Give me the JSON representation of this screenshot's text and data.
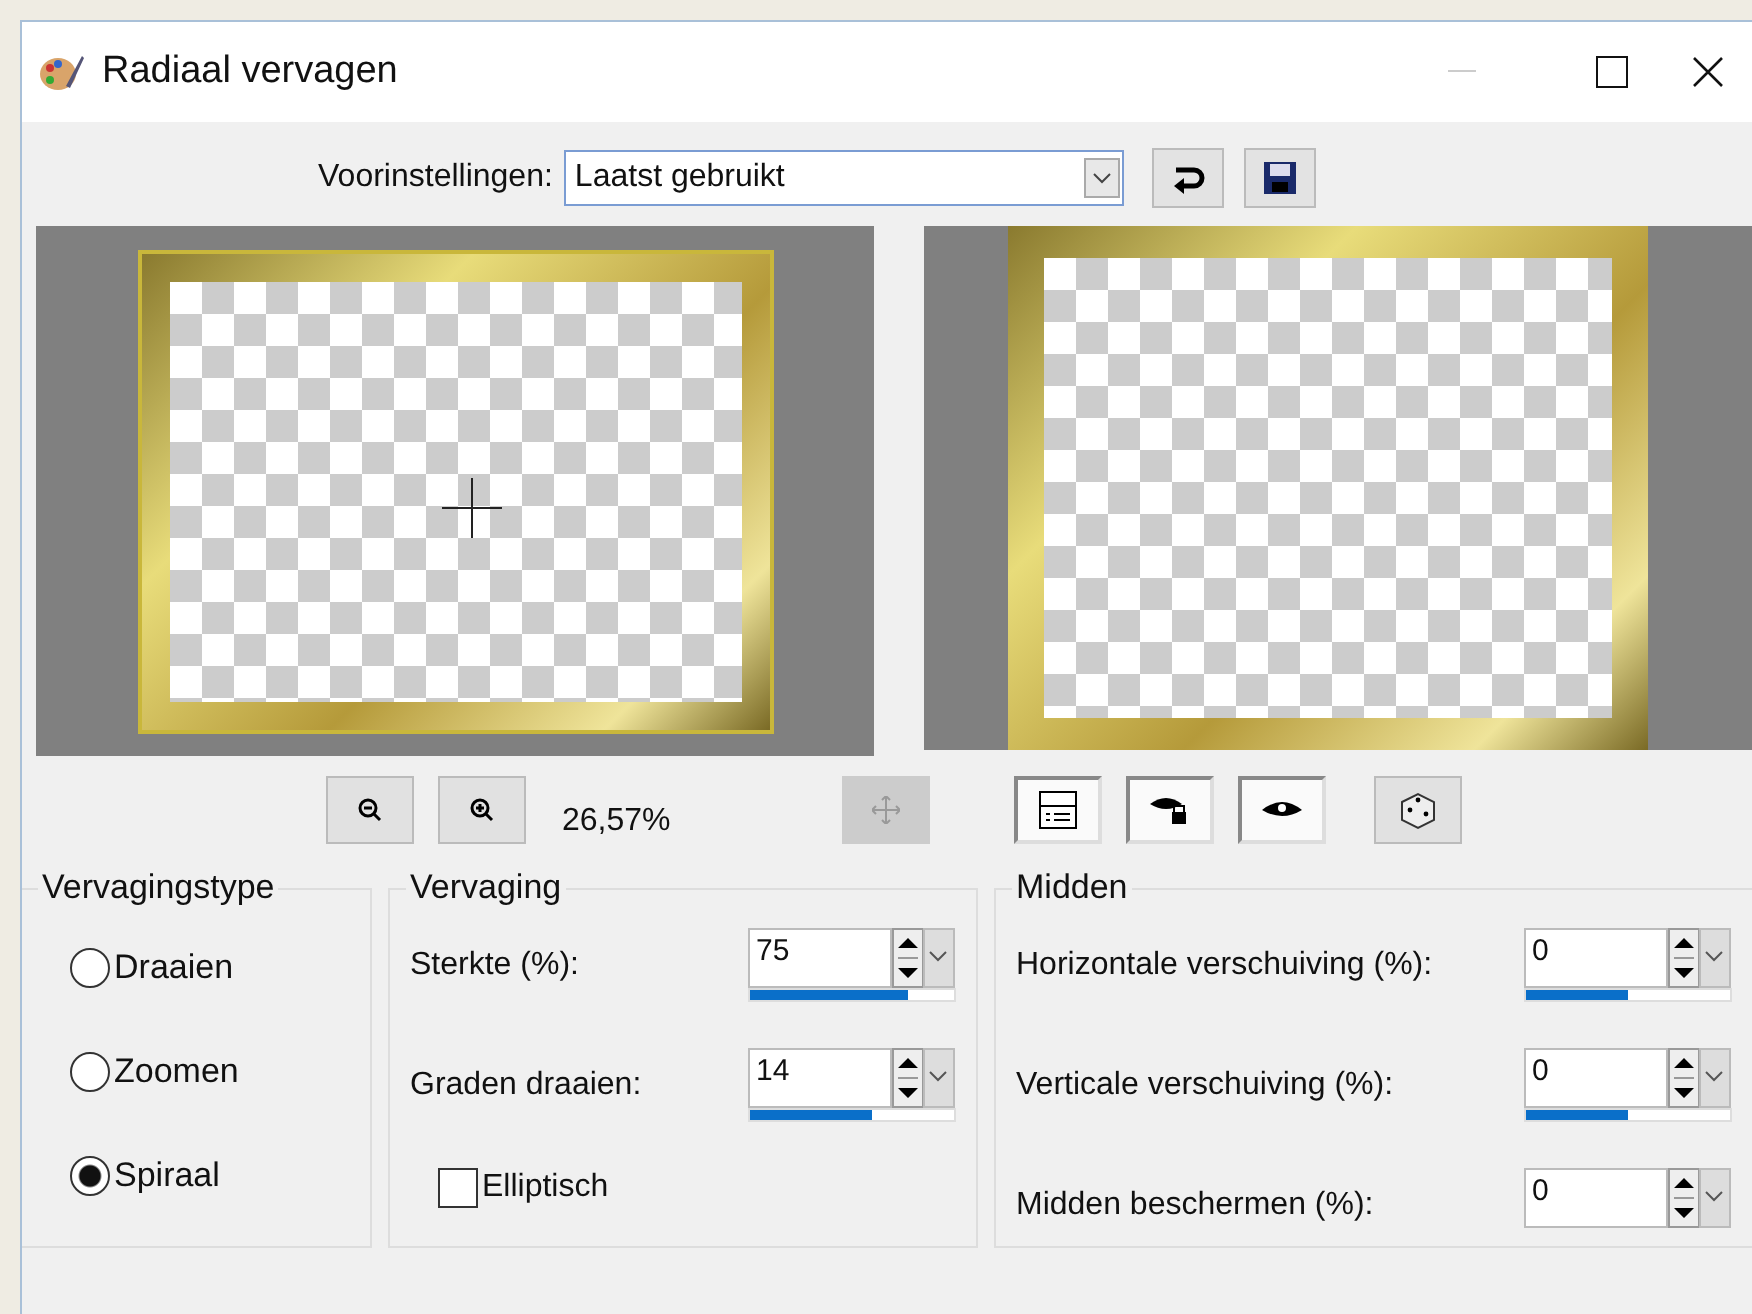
{
  "window": {
    "title": "Radiaal vervagen"
  },
  "presets": {
    "label": "Voorinstellingen:",
    "value": "Laatst gebruikt"
  },
  "zoom": {
    "reading": "26,57%"
  },
  "preview_buttons": [
    {
      "kind": "move",
      "disabled": true
    },
    {
      "kind": "layout",
      "pressed": true
    },
    {
      "kind": "eye-lock",
      "pressed": true
    },
    {
      "kind": "eye",
      "pressed": true
    },
    {
      "kind": "dice",
      "pressed": false
    }
  ],
  "blur_type": {
    "title": "Vervagingstype",
    "options": [
      {
        "label": "Draaien",
        "selected": false
      },
      {
        "label": "Zoomen",
        "selected": false
      },
      {
        "label": "Spiraal",
        "selected": true
      }
    ]
  },
  "blur": {
    "title": "Vervaging",
    "fields": [
      {
        "label": "Sterkte (%):",
        "value": "75",
        "level": 0.77
      },
      {
        "label": "Graden draaien:",
        "value": "14",
        "level": 0.6
      }
    ],
    "elliptic": {
      "label": "Elliptisch",
      "checked": false
    }
  },
  "center": {
    "title": "Midden",
    "fields": [
      {
        "label": "Horizontale verschuiving (%):",
        "value": "0",
        "level": 0.5
      },
      {
        "label": "Verticale verschuiving (%):",
        "value": "0",
        "level": 0.5
      },
      {
        "label": "Midden beschermen (%):",
        "value": "0"
      }
    ]
  }
}
